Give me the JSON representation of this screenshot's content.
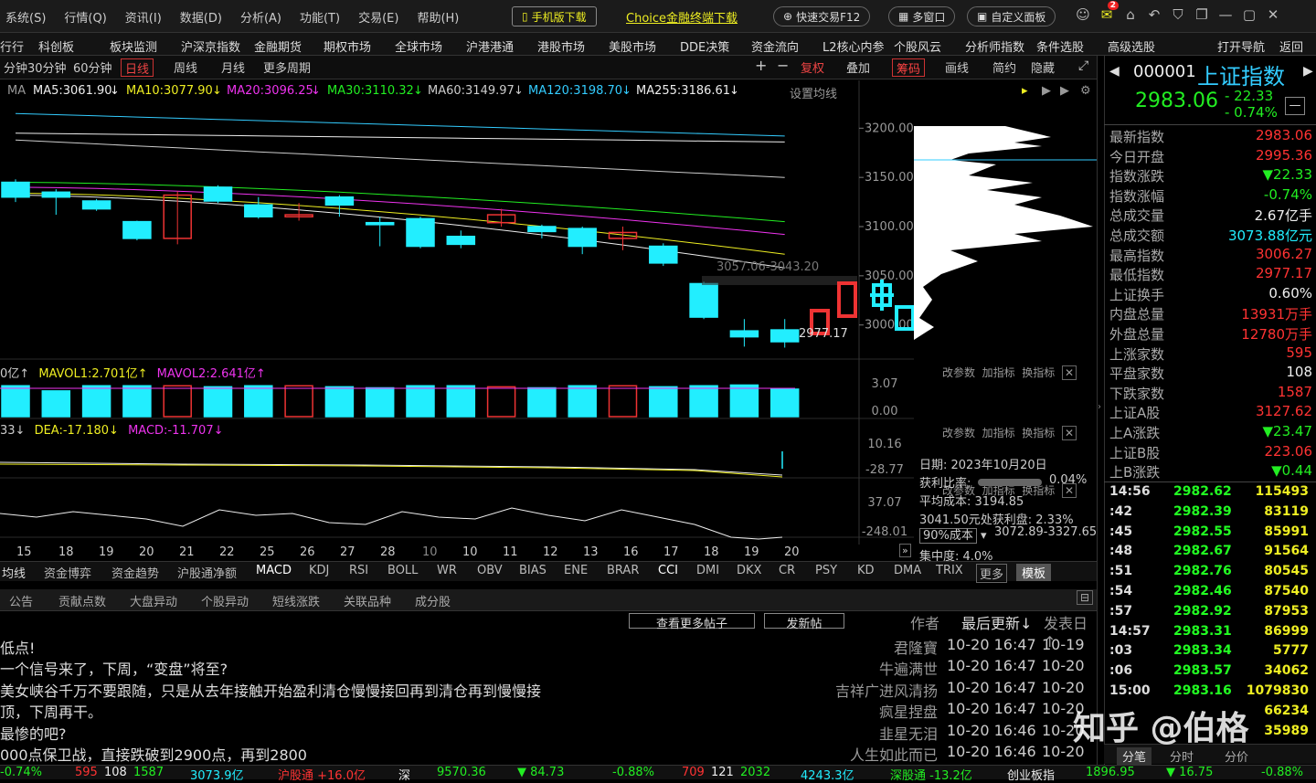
{
  "menubar": {
    "items": [
      "系统(S)",
      "行情(Q)",
      "资讯(I)",
      "数据(D)",
      "分析(A)",
      "功能(T)",
      "交易(E)",
      "帮助(H)"
    ],
    "mobile_btn": "手机版下载",
    "choice_link": "Choice金融终端下载",
    "fast_trade": "快速交易F12",
    "multi_window": "多窗口",
    "custom_panel": "自定义面板",
    "mail_badge": "2"
  },
  "tabbar": {
    "items": [
      "行行",
      "科创板",
      "板块监测",
      "沪深京指数",
      "金融期货",
      "期权市场",
      "全球市场",
      "沪港港通",
      "港股市场",
      "美股市场",
      "DDE决策",
      "资金流向",
      "L2核心内参",
      "个股风云",
      "分析师指数",
      "条件选股",
      "高级选股"
    ],
    "open_nav": "打开导航",
    "back": "返回"
  },
  "periodbar": {
    "items": [
      "分钟",
      "30分钟",
      "60分钟",
      "日线",
      "周线",
      "月线",
      "更多周期"
    ],
    "active": "日线",
    "tools": [
      "+",
      "−",
      "复权",
      "叠加",
      "筹码",
      "画线",
      "简约",
      "隐藏"
    ]
  },
  "ma": {
    "prefix": "MA",
    "items": [
      {
        "label": "MA5:3061.90",
        "color": "#eeeeee"
      },
      {
        "label": "MA10:3077.90",
        "color": "#eeee22"
      },
      {
        "label": "MA20:3096.25",
        "color": "#ee33ee"
      },
      {
        "label": "MA30:3110.32",
        "color": "#22ee22"
      },
      {
        "label": "MA60:3149.97",
        "color": "#cccccc"
      },
      {
        "label": "MA120:3198.70",
        "color": "#33ccff"
      },
      {
        "label": "MA255:3186.61",
        "color": "#eeeeee"
      }
    ],
    "settings": "设置均线"
  },
  "axis": {
    "main": [
      "3200.00",
      "3150.00",
      "3100.00",
      "3050.00",
      "3000.00"
    ],
    "vol": [
      "3.07",
      "0.00"
    ],
    "macd": [
      "10.16",
      "-28.77"
    ],
    "ind3": [
      "37.07",
      "-248.01"
    ]
  },
  "annotations": {
    "range": "3057.06-3043.20",
    "low": "2977.17"
  },
  "vol_header": {
    "left": "0亿↑",
    "mavol1": "MAVOL1:2.701亿↑",
    "mavol2": "MAVOL2:2.641亿↑"
  },
  "macd_header": {
    "left": "33↓",
    "dea": "DEA:-17.180↓",
    "macd": "MACD:-11.707↓"
  },
  "subbtns": [
    "改参数",
    "加指标",
    "换指标"
  ],
  "dates": [
    "15",
    "18",
    "19",
    "20",
    "21",
    "22",
    "25",
    "26",
    "27",
    "28",
    "10",
    "10",
    "11",
    "12",
    "13",
    "16",
    "17",
    "18",
    "19",
    "20"
  ],
  "chip": {
    "date": "日期: 2023年10月20日",
    "profit_label": "获利比率:",
    "profit": "0.04%",
    "avg_cost": "平均成本: 3194.85",
    "profit_at": "3041.50元处获利盘: 2.33%",
    "cost_select": "90%成本",
    "cost_range": "3072.89-3327.65",
    "concentration": "集中度: 4.0%"
  },
  "indtabs": [
    "均线",
    "资金博弈",
    "资金趋势",
    "沪股通净额",
    "MACD",
    "KDJ",
    "RSI",
    "BOLL",
    "WR",
    "OBV",
    "BIAS",
    "ENE",
    "BRAR",
    "CCI",
    "DMI",
    "DKX",
    "CR",
    "PSY",
    "KD",
    "DMA",
    "TRIX",
    "更多",
    "模板"
  ],
  "btabs": [
    "公告",
    "贡献点数",
    "大盘异动",
    "个股异动",
    "短线涨跌",
    "关联品种",
    "成分股"
  ],
  "posts_header": {
    "more": "查看更多帖子",
    "post": "发新帖",
    "author": "作者",
    "updated": "最后更新↓",
    "published": "发表日↑"
  },
  "posts": [
    {
      "title": "低点!",
      "author": "君隆寶",
      "updated": "10-20 16:47",
      "date": "10-19"
    },
    {
      "title": "一个信号来了，下周，“变盘”将至?",
      "author": "牛遍满世",
      "updated": "10-20 16:47",
      "date": "10-20"
    },
    {
      "title": "美女峡谷千万不要跟随，只是从去年接触开始盈利清仓慢慢接回再到清仓再到慢慢接",
      "author": "吉祥广进风清扬",
      "updated": "10-20 16:47",
      "date": "10-20"
    },
    {
      "title": "顶，下周再干。",
      "author": "疯星捏盘",
      "updated": "10-20 16:47",
      "date": "10-20"
    },
    {
      "title": "最惨的吧?",
      "author": "韭星无泪",
      "updated": "10-20 16:46",
      "date": "10-20"
    },
    {
      "title": "000点保卫战，直接跌破到2900点，再到2800",
      "author": "人生如此而已",
      "updated": "10-20 16:46",
      "date": "10-20"
    }
  ],
  "status": {
    "items": [
      "-0.74%",
      "595",
      "108",
      "1587",
      "3073.9亿",
      "沪股通 +16.0亿",
      "深",
      "9570.36",
      "▼ 84.73",
      "-0.88%",
      "709",
      "121",
      "2032",
      "4243.3亿",
      "深股通 -13.2亿",
      "创业板指",
      "1896.95",
      "▼ 16.75",
      "-0.88%"
    ]
  },
  "quote": {
    "code": "000001",
    "name": "上证指数",
    "price": "2983.06",
    "change": "- 22.33",
    "pct": "- 0.74%",
    "rows": [
      {
        "label": "最新指数",
        "value": "2983.06",
        "color": "red"
      },
      {
        "label": "今日开盘",
        "value": "2995.36",
        "color": "red"
      },
      {
        "label": "指数涨跌",
        "value": "▼22.33",
        "color": "green"
      },
      {
        "label": "指数涨幅",
        "value": "-0.74%",
        "color": "green"
      },
      {
        "label": "总成交量",
        "value": "2.67亿手",
        "color": "white"
      },
      {
        "label": "总成交额",
        "value": "3073.88亿元",
        "color": "cyan"
      },
      {
        "label": "最高指数",
        "value": "3006.27",
        "color": "red"
      },
      {
        "label": "最低指数",
        "value": "2977.17",
        "color": "red"
      },
      {
        "label": "上证换手",
        "value": "0.60%",
        "color": "white"
      },
      {
        "label": "内盘总量",
        "value": "13931万手",
        "color": "red"
      },
      {
        "label": "外盘总量",
        "value": "12780万手",
        "color": "red"
      },
      {
        "label": "上涨家数",
        "value": "595",
        "color": "red"
      },
      {
        "label": "平盘家数",
        "value": "108",
        "color": "white"
      },
      {
        "label": "下跌家数",
        "value": "1587",
        "color": "red"
      },
      {
        "label": "上证A股",
        "value": "3127.62",
        "color": "red"
      },
      {
        "label": "上A涨跌",
        "value": "▼23.47",
        "color": "green"
      },
      {
        "label": "上证B股",
        "value": "223.06",
        "color": "red"
      },
      {
        "label": "上B涨跌",
        "value": "▼0.44",
        "color": "green"
      }
    ],
    "ticks": [
      {
        "time": "14:56",
        "price": "2982.62",
        "vol": "115493"
      },
      {
        "time": ":42",
        "price": "2982.39",
        "vol": "83119"
      },
      {
        "time": ":45",
        "price": "2982.55",
        "vol": "85991"
      },
      {
        "time": ":48",
        "price": "2982.67",
        "vol": "91564"
      },
      {
        "time": ":51",
        "price": "2982.76",
        "vol": "80545"
      },
      {
        "time": ":54",
        "price": "2982.46",
        "vol": "87540"
      },
      {
        "time": ":57",
        "price": "2982.92",
        "vol": "87953"
      },
      {
        "time": "14:57",
        "price": "2983.31",
        "vol": "86999"
      },
      {
        "time": ":03",
        "price": "2983.34",
        "vol": "5777"
      },
      {
        "time": ":06",
        "price": "2983.57",
        "vol": "34062"
      },
      {
        "time": "15:00",
        "price": "2983.16",
        "vol": "1079830"
      },
      {
        "time": "",
        "price": "",
        "vol": "66234"
      },
      {
        "time": "",
        "price": "",
        "vol": "35989"
      }
    ],
    "bottom_tabs": [
      "分笔",
      "分时",
      "分价"
    ]
  },
  "watermark": "知乎 @伯格",
  "chart_data": {
    "type": "candlestick",
    "candles": [
      {
        "date": "15",
        "open": 3145,
        "close": 3130,
        "high": 3148,
        "low": 3125
      },
      {
        "date": "18",
        "open": 3135,
        "close": 3130,
        "high": 3138,
        "low": 3112
      },
      {
        "date": "19",
        "open": 3126,
        "close": 3118,
        "high": 3128,
        "low": 3116
      },
      {
        "date": "20",
        "open": 3105,
        "close": 3088,
        "high": 3106,
        "low": 3086
      },
      {
        "date": "21",
        "open": 3088,
        "close": 3132,
        "high": 3136,
        "low": 3082
      },
      {
        "date": "22",
        "open": 3140,
        "close": 3126,
        "high": 3142,
        "low": 3124
      },
      {
        "date": "25",
        "open": 3122,
        "close": 3110,
        "high": 3130,
        "low": 3108
      },
      {
        "date": "26",
        "open": 3110,
        "close": 3112,
        "high": 3124,
        "low": 3106
      },
      {
        "date": "27",
        "open": 3130,
        "close": 3122,
        "high": 3132,
        "low": 3110
      },
      {
        "date": "28",
        "open": 3104,
        "close": 3102,
        "high": 3110,
        "low": 3080
      },
      {
        "date": "10",
        "open": 3108,
        "close": 3080,
        "high": 3110,
        "low": 3078
      },
      {
        "date": "10",
        "open": 3090,
        "close": 3082,
        "high": 3096,
        "low": 3078
      },
      {
        "date": "11",
        "open": 3104,
        "close": 3112,
        "high": 3118,
        "low": 3100
      },
      {
        "date": "12",
        "open": 3100,
        "close": 3095,
        "high": 3102,
        "low": 3088
      },
      {
        "date": "13",
        "open": 3098,
        "close": 3080,
        "high": 3100,
        "low": 3072
      },
      {
        "date": "16",
        "open": 3088,
        "close": 3094,
        "high": 3100,
        "low": 3076
      },
      {
        "date": "17",
        "open": 3080,
        "close": 3063,
        "high": 3083,
        "low": 3060
      },
      {
        "date": "18",
        "open": 3042,
        "close": 3008,
        "high": 3044,
        "low": 3006
      },
      {
        "date": "19",
        "open": 2994,
        "close": 2988,
        "high": 3006,
        "low": 2978
      },
      {
        "date": "20",
        "open": 2995,
        "close": 2983,
        "high": 3006,
        "low": 2977
      }
    ],
    "volume": [
      3.0,
      2.5,
      3.0,
      3.0,
      3.0,
      2.9,
      3.0,
      3.0,
      2.9,
      2.8,
      3.0,
      3.0,
      2.9,
      2.8,
      3.0,
      3.0,
      2.9,
      3.0,
      3.07,
      2.67
    ],
    "ylim": [
      2970,
      3230
    ]
  }
}
